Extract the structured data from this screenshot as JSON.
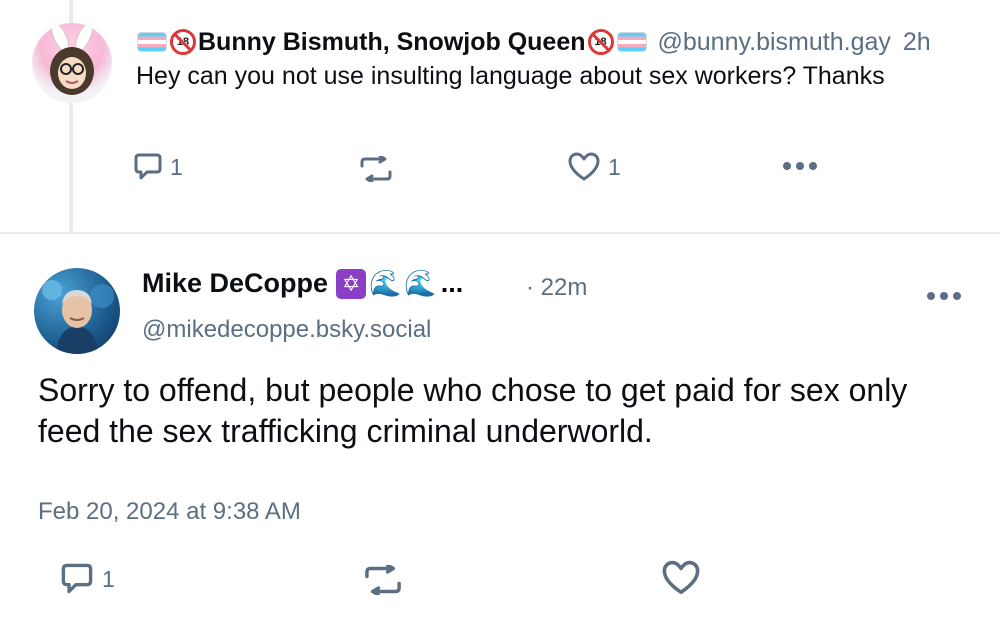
{
  "reply": {
    "display_name": "Bunny Bismuth, Snowjob Queen",
    "handle": "@bunny.bismuth.gay",
    "age": "2h",
    "text": "Hey can you not use insulting language about sex workers? Thanks",
    "reply_count": "1",
    "like_count": "1"
  },
  "post": {
    "display_name": "Mike DeCoppe",
    "name_ellipsis": "...",
    "age": "· 22m",
    "handle": "@mikedecoppe.bsky.social",
    "text": "Sorry to offend, but people who chose to get paid for sex only feed the sex trafficking criminal underworld.",
    "date": "Feb 20, 2024 at 9:38 AM",
    "reply_count": "1"
  },
  "icons": [
    "reply-icon",
    "repost-icon",
    "like-icon",
    "more-icon",
    "trans-flag-icon",
    "no-under-18-icon",
    "star-of-david-icon",
    "wave-icon"
  ],
  "colors": {
    "muted": "#5c6e81",
    "divider": "#e6ebf0",
    "text": "#0b0f14"
  }
}
